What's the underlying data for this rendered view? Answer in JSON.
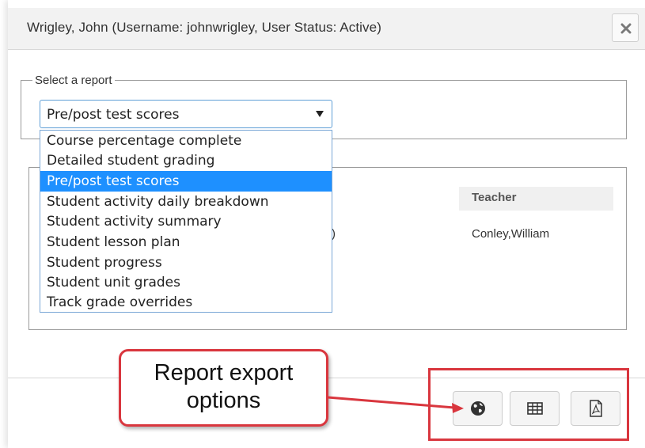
{
  "modal": {
    "title": "Wrigley, John (Username: johnwrigley, User Status: Active)",
    "close_icon": "close-icon"
  },
  "report_selector": {
    "legend": "Select a report",
    "selected_value": "Pre/post test scores",
    "options": [
      "Course percentage complete",
      "Detailed student grading",
      "Pre/post test scores",
      "Student activity daily breakdown",
      "Student activity summary",
      "Student lesson plan",
      "Student progress",
      "Student unit grades",
      "Track grade overrides"
    ],
    "highlighted_index": 2
  },
  "results": {
    "teacher_header": "Teacher",
    "teacher_name": "Conley,William",
    "partial_text": ")"
  },
  "export_buttons": [
    {
      "name": "web-export-button",
      "icon": "globe-icon"
    },
    {
      "name": "spreadsheet-export-button",
      "icon": "table-icon"
    },
    {
      "name": "pdf-export-button",
      "icon": "pdf-icon"
    }
  ],
  "callout": {
    "text": "Report export\noptions",
    "color": "#d9363e"
  },
  "colors": {
    "header_bg": "#f2f2f2",
    "selected_option_bg": "#1e90ff",
    "select_border": "#5e9ed6"
  }
}
